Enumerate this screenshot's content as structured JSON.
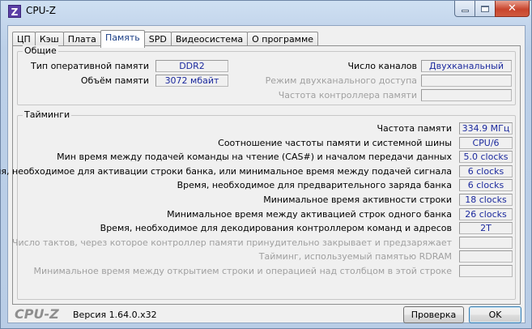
{
  "window": {
    "title": "CPU-Z",
    "app_icon_letter": "Z"
  },
  "tabs": [
    {
      "label": "ЦП"
    },
    {
      "label": "Кэш"
    },
    {
      "label": "Плата"
    },
    {
      "label": "Память"
    },
    {
      "label": "SPD"
    },
    {
      "label": "Видеосистема"
    },
    {
      "label": "О программе"
    }
  ],
  "active_tab": "Память",
  "general": {
    "title": "Общие",
    "type_label": "Тип оперативной памяти",
    "type_value": "DDR2",
    "size_label": "Объём памяти",
    "size_value": "3072 мбайт",
    "channels_label": "Число каналов",
    "channels_value": "Двухканальный",
    "dc_mode_label": "Режим двухканального доступа",
    "dc_mode_value": "",
    "nb_freq_label": "Частота контроллера памяти",
    "nb_freq_value": ""
  },
  "timings": {
    "title": "Тайминги",
    "rows": [
      {
        "label": "Частота памяти",
        "value": "334.9 МГц",
        "dim": false
      },
      {
        "label": "Соотношение частоты памяти и системной шины",
        "value": "CPU/6",
        "dim": false
      },
      {
        "label": "Мин время между подачей команды на чтение (CAS#) и началом передачи данных",
        "value": "5.0 clocks",
        "dim": false
      },
      {
        "label": "Время, необходимое для активации строки банка, или минимальное время между подачей сигнала",
        "value": "6 clocks",
        "dim": false
      },
      {
        "label": "Время, необходимое для предварительного заряда банка",
        "value": "6 clocks",
        "dim": false
      },
      {
        "label": "Минимальное время активности строки",
        "value": "18 clocks",
        "dim": false
      },
      {
        "label": "Минимальное время между активацией строк одного банка",
        "value": "26 clocks",
        "dim": false
      },
      {
        "label": "Время, необходимое для декодирования контроллером команд и адресов",
        "value": "2T",
        "dim": false
      },
      {
        "label": "Число тактов, через которое контроллер памяти принудительно закрывает и предзаряжает",
        "value": "",
        "dim": true
      },
      {
        "label": "Тайминг, используемый памятью RDRAM",
        "value": "",
        "dim": true
      },
      {
        "label": "Минимальное время между открытием строки и операцией над столбцом в этой строке",
        "value": "",
        "dim": true
      }
    ]
  },
  "footer": {
    "brand": "CPU-Z",
    "version": "Версия 1.64.0.x32",
    "validate_label": "Проверка",
    "ok_label": "OK"
  }
}
